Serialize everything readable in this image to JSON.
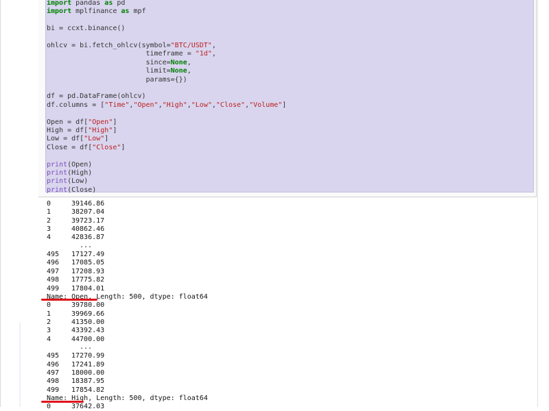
{
  "code_lines": [
    {
      "parts": [
        {
          "t": "import",
          "c": "kw"
        },
        {
          "t": " pandas "
        },
        {
          "t": "as",
          "c": "kw"
        },
        {
          "t": " pd"
        }
      ]
    },
    {
      "parts": [
        {
          "t": "import",
          "c": "kw"
        },
        {
          "t": " mplfinance "
        },
        {
          "t": "as",
          "c": "kw"
        },
        {
          "t": " mpf"
        }
      ]
    },
    {
      "parts": []
    },
    {
      "parts": [
        {
          "t": "bi = ccxt.binance()"
        }
      ]
    },
    {
      "parts": []
    },
    {
      "parts": [
        {
          "t": "ohlcv = bi.fetch_ohlcv(symbol="
        },
        {
          "t": "\"BTC/USDT\"",
          "c": "str"
        },
        {
          "t": ","
        }
      ]
    },
    {
      "parts": [
        {
          "t": "                        timeframe = "
        },
        {
          "t": "\"1d\"",
          "c": "str"
        },
        {
          "t": ","
        }
      ]
    },
    {
      "parts": [
        {
          "t": "                        since="
        },
        {
          "t": "None",
          "c": "kw"
        },
        {
          "t": ","
        }
      ]
    },
    {
      "parts": [
        {
          "t": "                        limit="
        },
        {
          "t": "None",
          "c": "kw"
        },
        {
          "t": ","
        }
      ]
    },
    {
      "parts": [
        {
          "t": "                        params={})"
        }
      ]
    },
    {
      "parts": []
    },
    {
      "parts": [
        {
          "t": "df = pd.DataFrame(ohlcv)"
        }
      ]
    },
    {
      "parts": [
        {
          "t": "df.columns = ["
        },
        {
          "t": "\"Time\"",
          "c": "str"
        },
        {
          "t": ","
        },
        {
          "t": "\"Open\"",
          "c": "str"
        },
        {
          "t": ","
        },
        {
          "t": "\"High\"",
          "c": "str"
        },
        {
          "t": ","
        },
        {
          "t": "\"Low\"",
          "c": "str"
        },
        {
          "t": ","
        },
        {
          "t": "\"Close\"",
          "c": "str"
        },
        {
          "t": ","
        },
        {
          "t": "\"Volume\"",
          "c": "str"
        },
        {
          "t": "]"
        }
      ]
    },
    {
      "parts": []
    },
    {
      "parts": [
        {
          "t": "Open = df["
        },
        {
          "t": "\"Open\"",
          "c": "str"
        },
        {
          "t": "]"
        }
      ]
    },
    {
      "parts": [
        {
          "t": "High = df["
        },
        {
          "t": "\"High\"",
          "c": "str"
        },
        {
          "t": "]"
        }
      ]
    },
    {
      "parts": [
        {
          "t": "Low = df["
        },
        {
          "t": "\"Low\"",
          "c": "str"
        },
        {
          "t": "]"
        }
      ]
    },
    {
      "parts": [
        {
          "t": "Close = df["
        },
        {
          "t": "\"Close\"",
          "c": "str"
        },
        {
          "t": "]"
        }
      ]
    },
    {
      "parts": []
    },
    {
      "parts": [
        {
          "t": "print",
          "c": "kw2"
        },
        {
          "t": "(Open)"
        }
      ]
    },
    {
      "parts": [
        {
          "t": "print",
          "c": "kw2"
        },
        {
          "t": "(High)"
        }
      ]
    },
    {
      "parts": [
        {
          "t": "print",
          "c": "kw2"
        },
        {
          "t": "(Low)"
        }
      ]
    },
    {
      "parts": [
        {
          "t": "print",
          "c": "kw2"
        },
        {
          "t": "(Close)"
        }
      ]
    }
  ],
  "output_blocks": [
    {
      "rows_top": [
        [
          "0",
          "39146.86"
        ],
        [
          "1",
          "38207.04"
        ],
        [
          "2",
          "39723.17"
        ],
        [
          "3",
          "40862.46"
        ],
        [
          "4",
          "42836.87"
        ]
      ],
      "ellipsis": "...",
      "rows_bottom": [
        [
          "495",
          "17127.49"
        ],
        [
          "496",
          "17085.05"
        ],
        [
          "497",
          "17208.93"
        ],
        [
          "498",
          "17775.82"
        ],
        [
          "499",
          "17804.01"
        ]
      ],
      "summary": "Name: Open, Length: 500, dtype: float64"
    },
    {
      "rows_top": [
        [
          "0",
          "39780.00"
        ],
        [
          "1",
          "39969.66"
        ],
        [
          "2",
          "41350.00"
        ],
        [
          "3",
          "43392.43"
        ],
        [
          "4",
          "44700.00"
        ]
      ],
      "ellipsis": "...",
      "rows_bottom": [
        [
          "495",
          "17270.99"
        ],
        [
          "496",
          "17241.89"
        ],
        [
          "497",
          "18000.00"
        ],
        [
          "498",
          "18387.95"
        ],
        [
          "499",
          "17854.82"
        ]
      ],
      "summary": "Name: High, Length: 500, dtype: float64"
    }
  ],
  "partial_next_row": [
    "0",
    "37642.03"
  ],
  "colors": {
    "cell_bg": "#d9d5ee",
    "keyword": "#008000",
    "string": "#ba2121",
    "builtin": "#7a4cbd",
    "annotation": "#e0141c"
  }
}
